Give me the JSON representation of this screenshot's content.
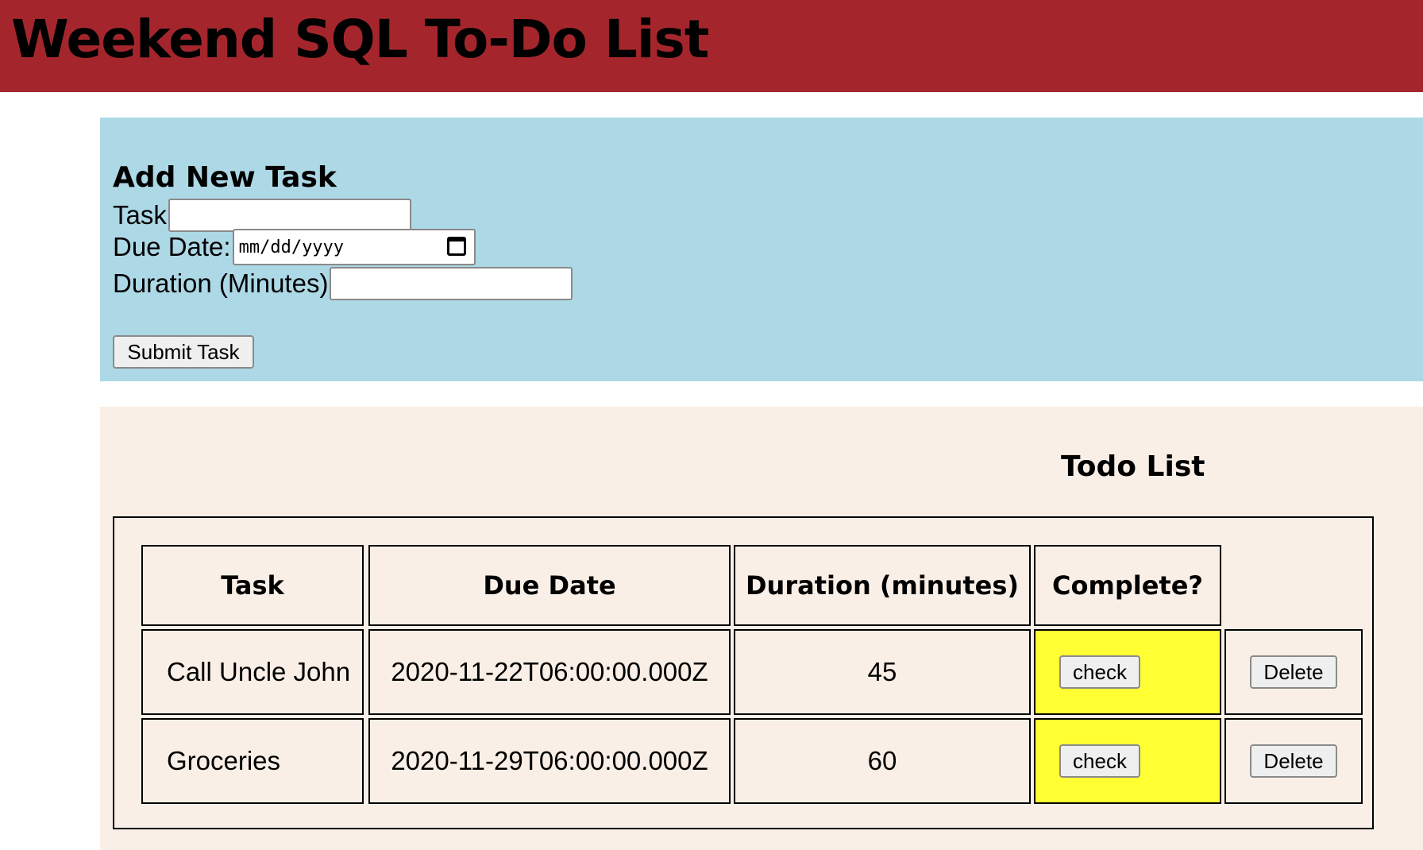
{
  "header": {
    "title": "Weekend SQL To-Do List"
  },
  "add_form": {
    "heading": "Add New Task",
    "task_label": "Task",
    "task_value": "",
    "due_label": "Due Date:",
    "due_placeholder": "mm/dd/yyyy",
    "duration_label": "Duration (Minutes)",
    "duration_value": "",
    "submit_label": "Submit Task"
  },
  "todo": {
    "heading": "Todo List",
    "columns": [
      "Task",
      "Due Date",
      "Duration (minutes)",
      "Complete?"
    ],
    "rows": [
      {
        "task": "Call Uncle John",
        "due": "2020-11-22T06:00:00.000Z",
        "duration": "45",
        "check_label": "check",
        "delete_label": "Delete"
      },
      {
        "task": "Groceries",
        "due": "2020-11-29T06:00:00.000Z",
        "duration": "60",
        "check_label": "check",
        "delete_label": "Delete"
      }
    ]
  },
  "colors": {
    "header_bg": "#a4262c",
    "form_bg": "#add8e6",
    "list_bg": "#f9efe6",
    "complete_cell_bg": "#ffff33"
  },
  "icons": {
    "date_picker": "calendar-icon"
  }
}
